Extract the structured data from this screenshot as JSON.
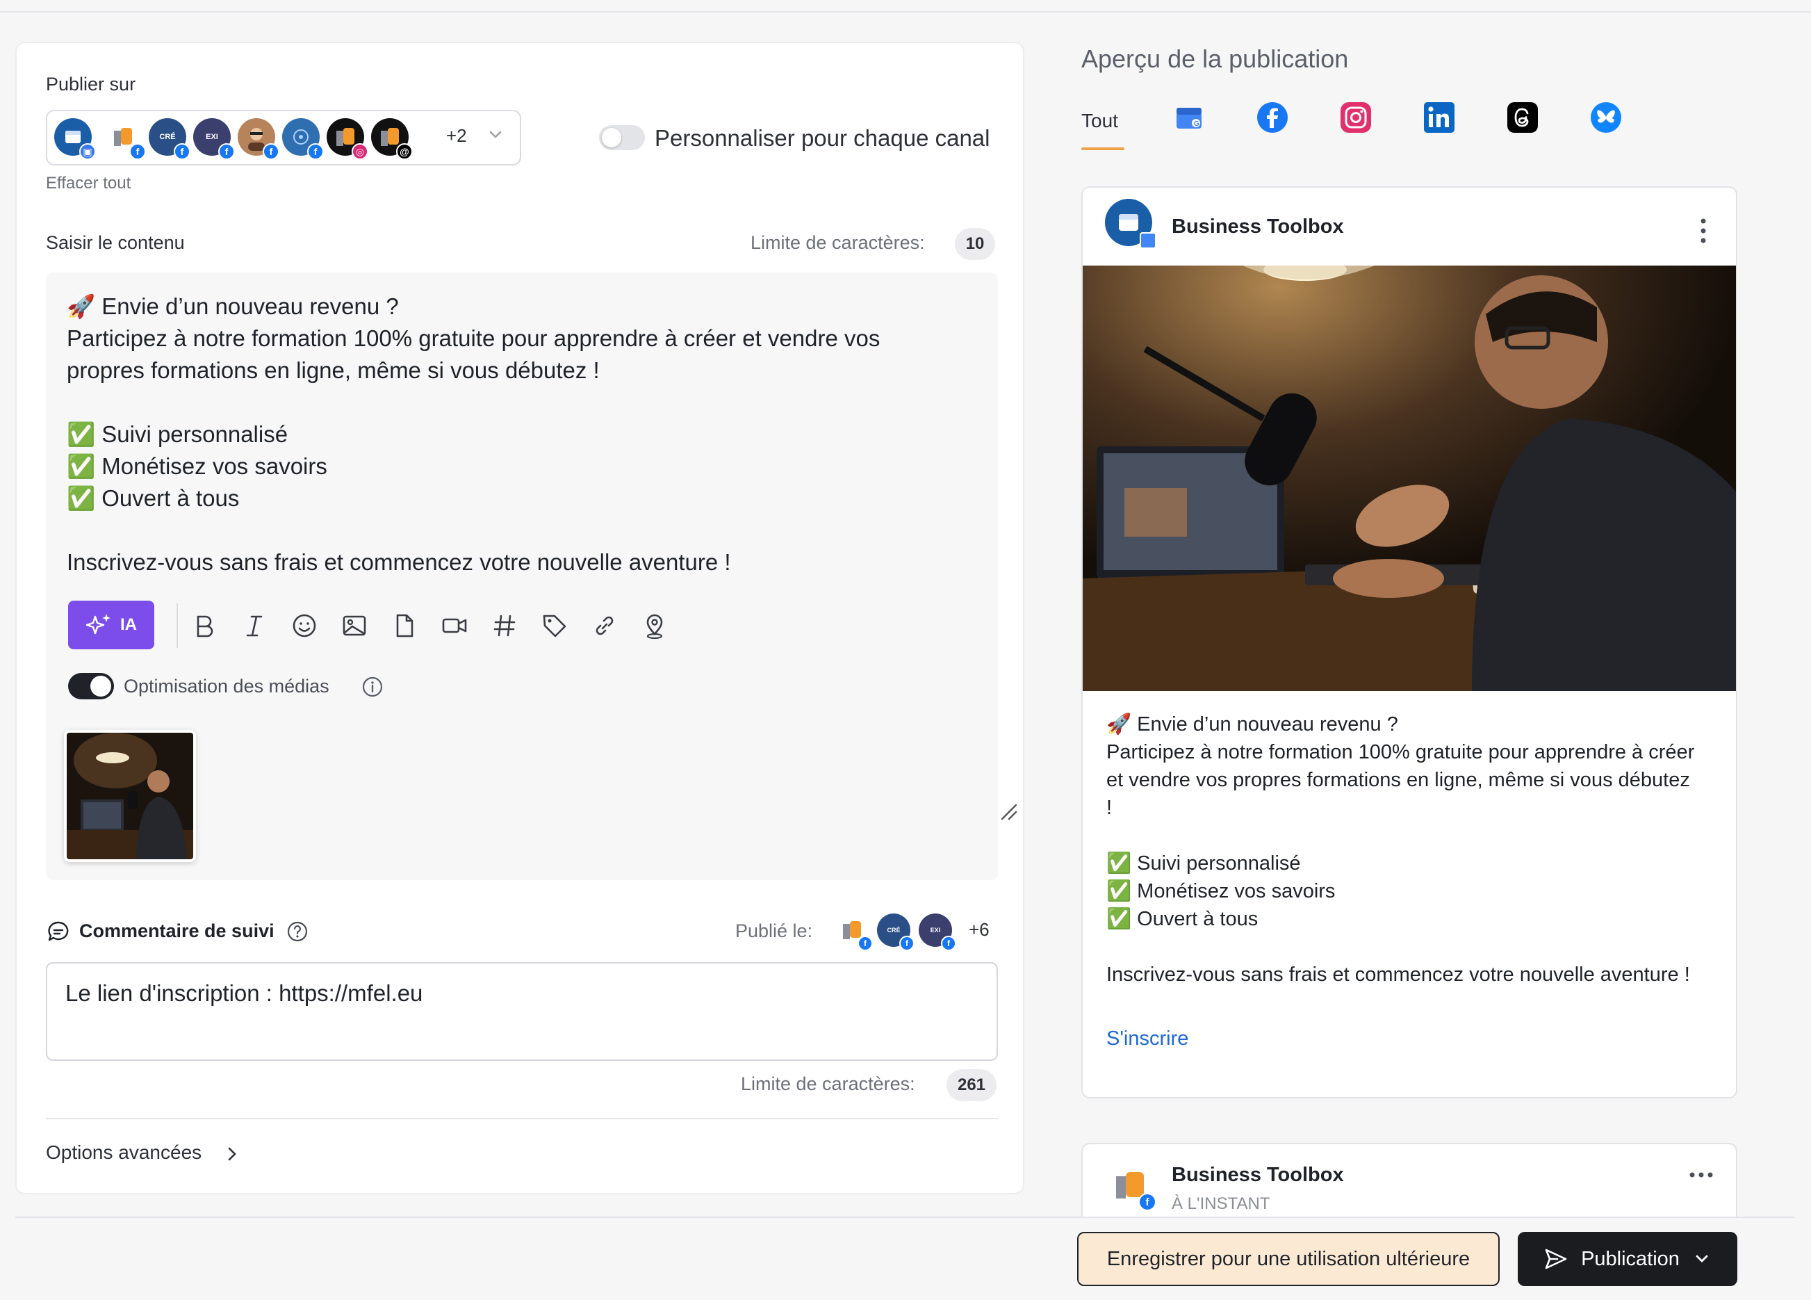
{
  "composer": {
    "publish_on_label": "Publier sur",
    "more_channels": "+2",
    "clear_all": "Effacer tout",
    "personalize_label": "Personnaliser pour chaque canal",
    "content_label": "Saisir le contenu",
    "char_limit_label": "Limite de caractères:",
    "char_limit_value": "10",
    "post_text": "🚀 Envie d’un nouveau revenu ?\nParticipez à notre formation 100% gratuite pour apprendre à créer et vendre vos\npropres formations en ligne, même si vous débutez !\n\n✅ Suivi personnalisé\n✅ Monétisez vos savoirs\n✅ Ouvert à tous\n\nInscrivez-vous sans frais et commencez votre nouvelle aventure !",
    "ai_label": "IA",
    "media_opt_label": "Optimisation des médias",
    "followup_label": "Commentaire de suivi",
    "published_on_label": "Publié le:",
    "published_more": "+6",
    "followup_text": "Le lien d'inscription : https://mfel.eu",
    "followup_limit_label": "Limite de caractères:",
    "followup_limit_value": "261",
    "advanced_label": "Options avancées"
  },
  "preview": {
    "title": "Aperçu de la publication",
    "tab_all": "Tout",
    "account_name": "Business Toolbox",
    "post_text": "🚀 Envie d’un nouveau revenu ?\nParticipez à notre formation 100% gratuite pour apprendre à créer\net vendre vos propres formations en ligne, même si vous débutez\n!\n\n✅ Suivi personnalisé\n✅ Monétisez vos savoirs\n✅ Ouvert à tous\n\nInscrivez-vous sans frais et commencez votre nouvelle aventure !",
    "link_label": "S'inscrire",
    "second_account_name": "Business Toolbox",
    "second_time": "À L'INSTANT"
  },
  "footer": {
    "save_label": "Enregistrer pour une utilisation ultérieure",
    "publish_label": "Publication"
  },
  "colors": {
    "accent_ai": "#7c4dea",
    "tab_underline": "#f0a24b",
    "link": "#1c69d4",
    "save_bg": "#fbe9d4"
  }
}
